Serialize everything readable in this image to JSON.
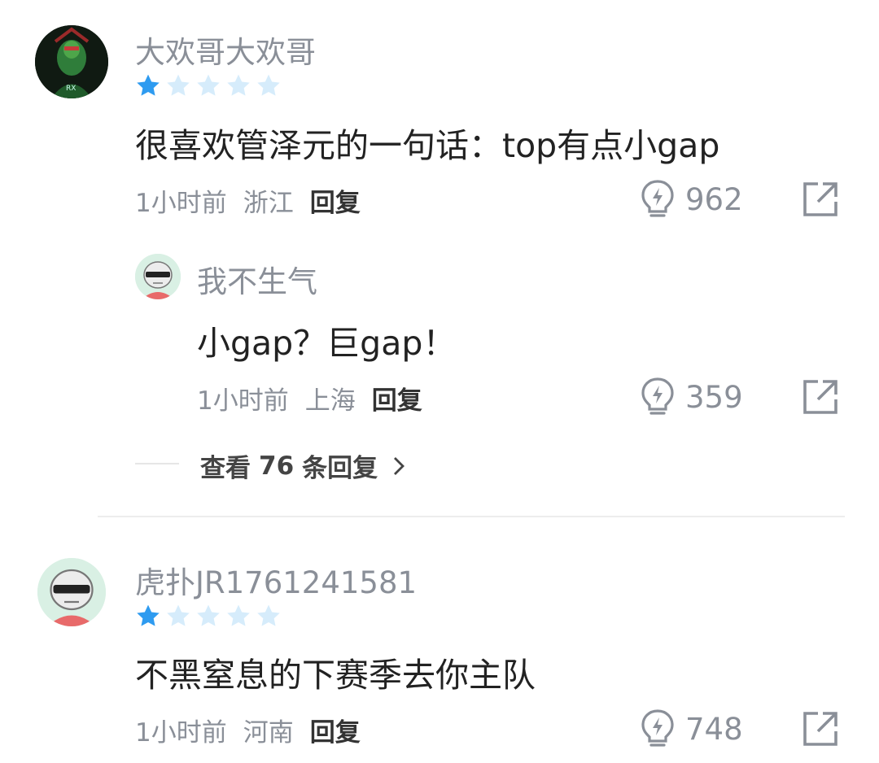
{
  "comments": [
    {
      "username": "大欢哥大欢哥",
      "rating": 1,
      "max_rating": 5,
      "text": "很喜欢管泽元的一句话：top有点小gap",
      "time": "1小时前",
      "location": "浙江",
      "reply_label": "回复",
      "likes": "962",
      "avatar_icon": "green-armored-hero-avatar",
      "replies": [
        {
          "username": "我不生气",
          "text": "小gap？巨gap！",
          "time": "1小时前",
          "location": "上海",
          "reply_label": "回复",
          "likes": "359",
          "avatar_icon": "default-sunglasses-avatar"
        }
      ],
      "view_more": {
        "prefix": "查看",
        "count": "76",
        "suffix": "条回复"
      }
    },
    {
      "username": "虎扑JR1761241581",
      "rating": 1,
      "max_rating": 5,
      "text": "不黑窒息的下赛季去你主队",
      "time": "1小时前",
      "location": "河南",
      "reply_label": "回复",
      "likes": "748",
      "avatar_icon": "default-sunglasses-avatar"
    }
  ],
  "colors": {
    "star_filled": "#2e9bf0",
    "star_empty": "#d6ecfb",
    "meta_text": "#8a8f98",
    "avatar_bg": "#d9f0e4"
  }
}
